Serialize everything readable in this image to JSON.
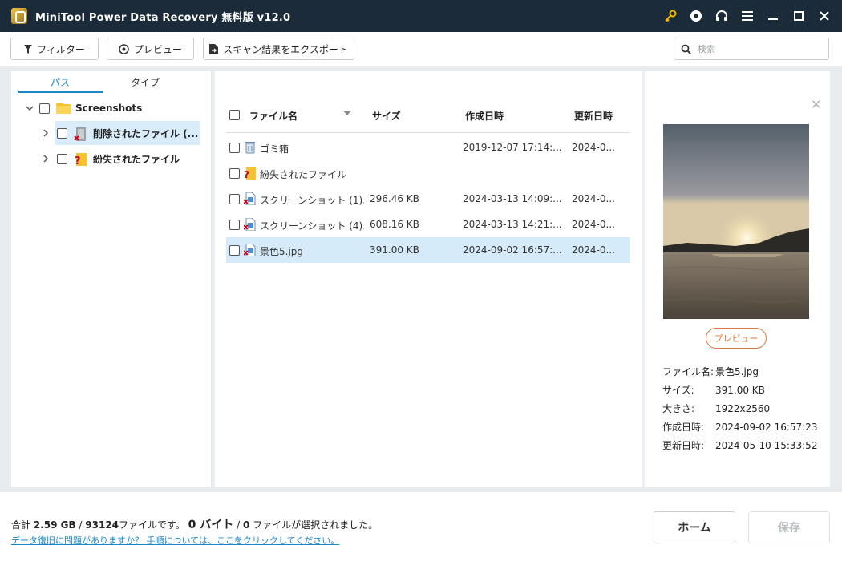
{
  "titlebar": {
    "title": "MiniTool Power Data Recovery 無料版 v12.0"
  },
  "toolbar": {
    "filter_label": "フィルター",
    "preview_label": "プレビュー",
    "export_label": "スキャン結果をエクスポート",
    "search_placeholder": "検索"
  },
  "left_pane": {
    "tabs": [
      {
        "label": "パス",
        "active": true
      },
      {
        "label": "タイプ",
        "active": false
      }
    ],
    "tree": {
      "root": {
        "label": "Screenshots",
        "icon": "folder-icon"
      },
      "children": [
        {
          "label": "削除されたファイル (...",
          "icon": "deleted-folder-icon",
          "selected": true
        },
        {
          "label": "紛失されたファイル",
          "icon": "lost-folder-icon",
          "selected": false
        }
      ]
    }
  },
  "file_list": {
    "columns": [
      "ファイル名",
      "サイズ",
      "作成日時",
      "更新日時"
    ],
    "rows": [
      {
        "name": "ゴミ箱",
        "size": "",
        "created": "2019-12-07 17:14:...",
        "modified": "2024-0...",
        "icon": "recycle-bin-icon",
        "selected": false
      },
      {
        "name": "紛失されたファイル",
        "size": "",
        "created": "",
        "modified": "",
        "icon": "lost-folder-icon",
        "selected": false
      },
      {
        "name": "スクリーンショット (1)....",
        "size": "296.46 KB",
        "created": "2024-03-13 14:09:...",
        "modified": "2024-0...",
        "icon": "deleted-image-icon",
        "selected": false
      },
      {
        "name": "スクリーンショット (4)....",
        "size": "608.16 KB",
        "created": "2024-03-13 14:21:...",
        "modified": "2024-0...",
        "icon": "deleted-image-icon",
        "selected": false
      },
      {
        "name": "景色5.jpg",
        "size": "391.00 KB",
        "created": "2024-09-02 16:57:...",
        "modified": "2024-0...",
        "icon": "deleted-image-icon",
        "selected": true
      }
    ]
  },
  "preview": {
    "button_label": "プレビュー",
    "info": [
      {
        "key": "ファイル名:",
        "value": "景色5.jpg"
      },
      {
        "key": "サイズ:",
        "value": "391.00 KB"
      },
      {
        "key": "大きさ:",
        "value": "1922x2560"
      },
      {
        "key": "作成日時:",
        "value": "2024-09-02 16:57:23"
      },
      {
        "key": "更新日時:",
        "value": "2024-05-10 15:33:52"
      }
    ]
  },
  "footer": {
    "total_prefix": "合計 ",
    "total_size": "2.59 GB",
    "sep": " / ",
    "total_files": "93124",
    "total_suffix": "ファイルです。 ",
    "selected_bytes": "0 バイト",
    "sep2": " / ",
    "selected_files": "0",
    "selected_suffix": " ファイルが選択されました。",
    "help_link": "データ復旧に問題がありますか？ 手順については、ここをクリックしてください。",
    "home_label": "ホーム",
    "save_label": "保存"
  },
  "colors": {
    "titlebar_bg": "#1c2b3a",
    "accent": "#1a85c7",
    "preview_button": "#e07a3a",
    "selection": "#d6ebfa"
  }
}
